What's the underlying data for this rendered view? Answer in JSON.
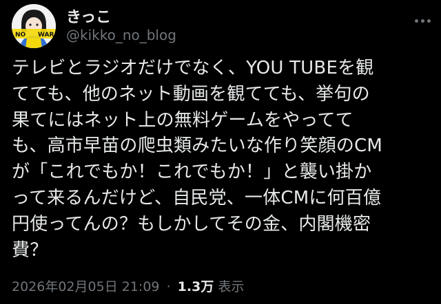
{
  "author": {
    "display_name": "きっこ",
    "handle": "@kikko_no_blog",
    "avatar_text_left": "NO",
    "avatar_text_right": "WAR"
  },
  "tweet": {
    "lines": [
      "テレビとラジオだけでなく、YOU TUBEを観",
      "てても、他のネット動画を観てても、挙句の",
      "果てにはネット上の無料ゲームをやってて",
      "も、高市早苗の爬虫類みたいな作り笑顔のCM",
      "が「これでもか！これでもか！」と襲い掛か",
      "って来るんだけど、自民党、一体CMに何百億",
      "円使ってんの？もしかしてその金、内閣機密",
      "費？"
    ],
    "timestamp": "2026年02月05日 21:09",
    "separator": "·",
    "views_count": "1.3万",
    "views_label": "表示"
  },
  "icons": {
    "more": "more-options-icon"
  },
  "colors": {
    "background": "#000000",
    "text_primary": "#e7e9ea",
    "text_secondary": "#71767b",
    "avatar_blue": "#2f6fd6",
    "avatar_yellow": "#f5d90a"
  }
}
